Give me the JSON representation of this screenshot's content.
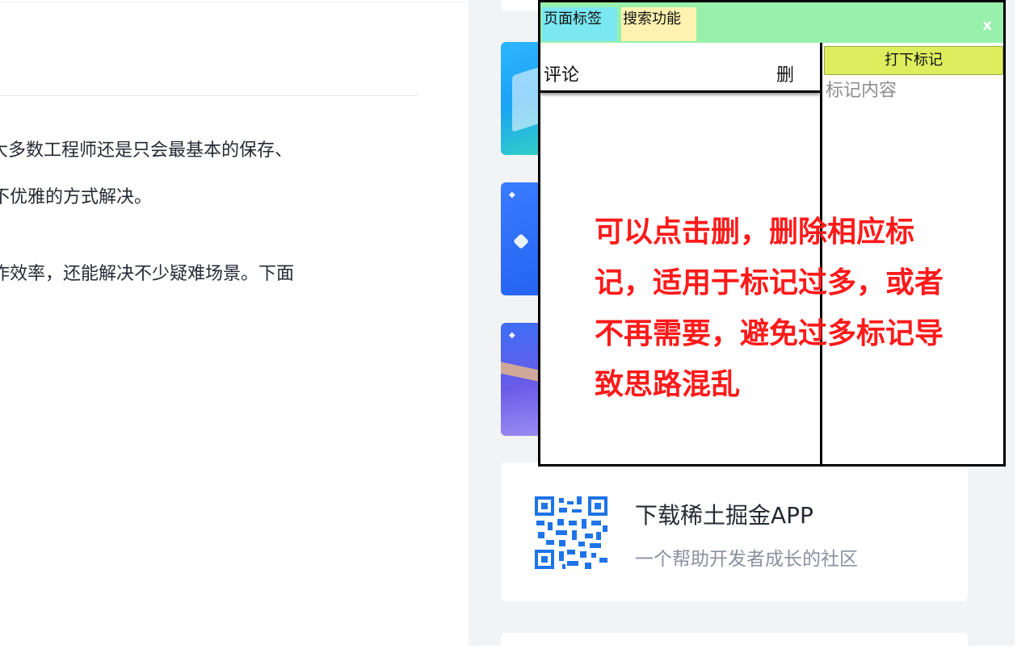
{
  "article": {
    "lines": [
      "大多数工程师还是只会最基本的保存、",
      "不优雅的方式解决。",
      "作效率，还能解决不少疑难场景。下面"
    ]
  },
  "sidebar": {
    "app_card": {
      "title": "下载稀土掘金APP",
      "subtitle": "一个帮助开发者成长的社区"
    }
  },
  "popup": {
    "tabs": [
      "页面标签",
      "搜索功能"
    ],
    "close": "x",
    "comment_label": "评论",
    "delete_label": "删",
    "mark_button": "打下标记",
    "mark_placeholder": "标记内容"
  },
  "annotation": {
    "text": "可以点击删，删除相应标记，适用于标记过多，或者不再需要，避免过多标记导致思路混乱",
    "color": "#ff1a1a"
  },
  "colors": {
    "header_bg": "#98f0ad",
    "tab_page_bg": "#7be7f0",
    "tab_search_bg": "#fdf2b0",
    "mark_button_bg": "#dcee5e"
  }
}
